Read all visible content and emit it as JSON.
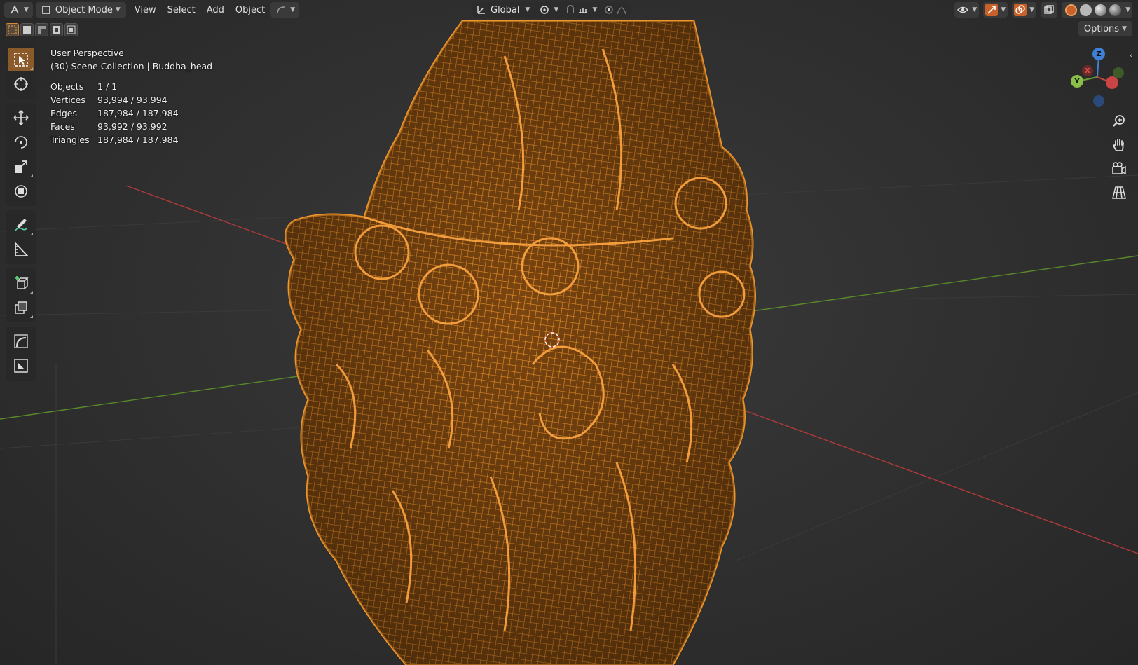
{
  "header": {
    "editor_type_icon": "editor-type-icon",
    "mode_label": "Object Mode",
    "menus": [
      "View",
      "Select",
      "Add",
      "Object"
    ],
    "transform_orientation": "Global"
  },
  "options_label": "Options",
  "overlay": {
    "view_name": "User Perspective",
    "collection_line": "(30) Scene Collection | Buddha_head",
    "stats": [
      {
        "label": "Objects",
        "value": "1 / 1"
      },
      {
        "label": "Vertices",
        "value": "93,994 / 93,994"
      },
      {
        "label": "Edges",
        "value": "187,984 / 187,984"
      },
      {
        "label": "Faces",
        "value": "93,992 / 93,992"
      },
      {
        "label": "Triangles",
        "value": "187,984 / 187,984"
      }
    ]
  },
  "gizmo": {
    "z": "Z",
    "y": "Y",
    "x": "X"
  },
  "colors": {
    "wire": "#f0952a",
    "wire_dark": "#8a4a10",
    "active_tool": "#8a5a2a",
    "x_axis": "#c94444",
    "y_axis": "#6a9a3a",
    "z_axis": "#3f7fd6"
  },
  "icons": {
    "tools": [
      "select-box-icon",
      "cursor-icon",
      "move-icon",
      "rotate-icon",
      "scale-icon",
      "transform-icon",
      "annotate-icon",
      "measure-icon",
      "add-cube-icon",
      "duplicate-icon",
      "curve-icon",
      "frame-icon"
    ],
    "nav": [
      "zoom-icon",
      "hand-pan-icon",
      "camera-icon",
      "grid-icon"
    ]
  }
}
